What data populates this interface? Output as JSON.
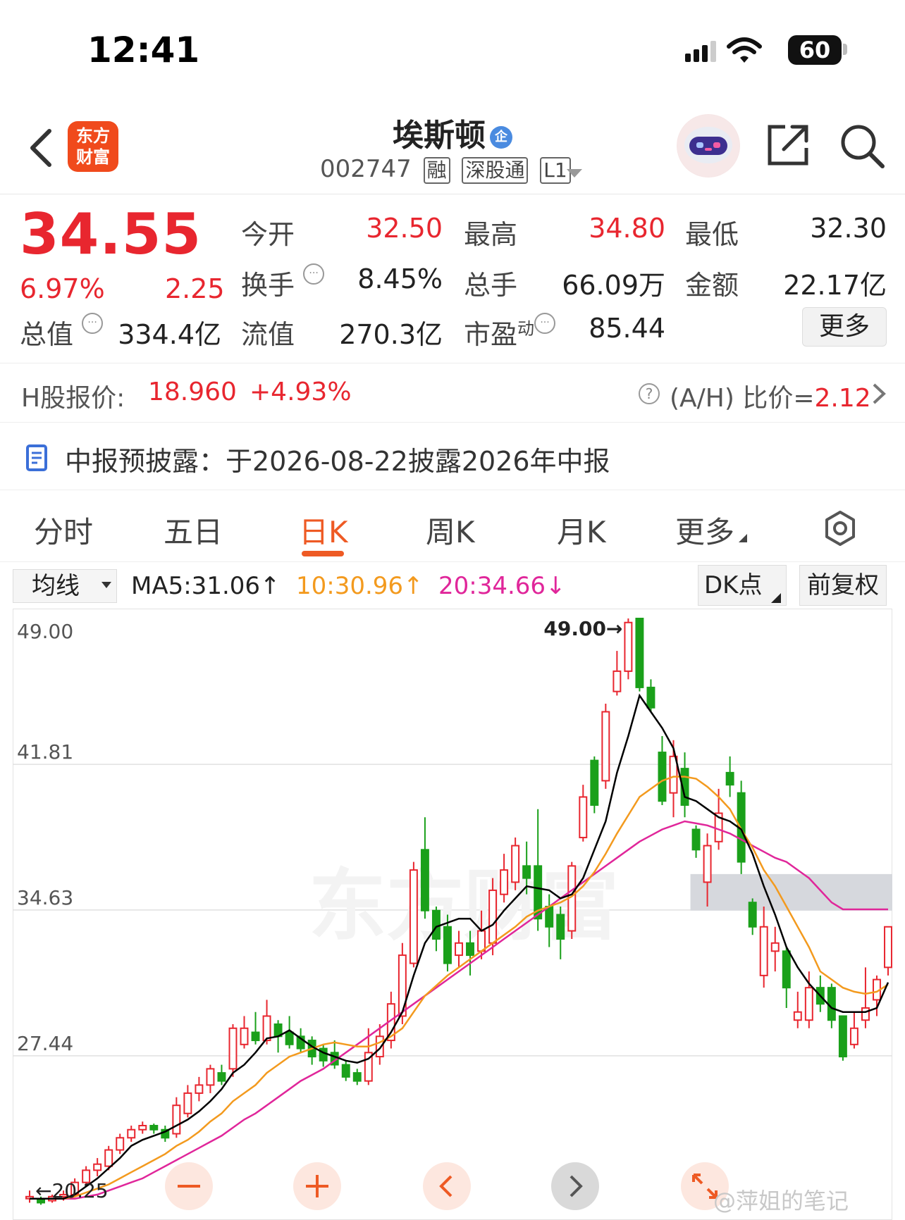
{
  "status_bar": {
    "time": "12:41",
    "battery": "60"
  },
  "header": {
    "app_logo_line1": "东方",
    "app_logo_line2": "财富",
    "stock_name": "埃斯顿",
    "verified_badge": "企",
    "stock_code": "002747",
    "tags": [
      "融",
      "深股通",
      "L1"
    ]
  },
  "quote": {
    "price": "34.55",
    "change_pct": "6.97%",
    "change_abs": "2.25",
    "fields": [
      {
        "label": "今开",
        "value": "32.50",
        "red": true
      },
      {
        "label": "最高",
        "value": "34.80",
        "red": true
      },
      {
        "label": "最低",
        "value": "32.30",
        "red": false
      },
      {
        "label": "换手",
        "value": "8.45%",
        "red": false
      },
      {
        "label": "总手",
        "value": "66.09万",
        "red": false
      },
      {
        "label": "金额",
        "value": "22.17亿",
        "red": false
      },
      {
        "label": "总值",
        "value": "334.4亿",
        "red": false
      },
      {
        "label": "流值",
        "value": "270.3亿",
        "red": false
      },
      {
        "label": "市盈",
        "value": "85.44",
        "red": false
      }
    ],
    "pe_superscript": "动",
    "more_label": "更多"
  },
  "hk": {
    "label": "H股报价:",
    "price": "18.960",
    "change": "+4.93%",
    "ratio_label": "(A/H) 比价=",
    "ratio_value": "2.12"
  },
  "report": {
    "text": "中报预披露：于2026-08-22披露2026年中报"
  },
  "tabs": [
    "分时",
    "五日",
    "日K",
    "周K",
    "月K",
    "更多"
  ],
  "active_tab": "日K",
  "ma_bar": {
    "select_label": "均线",
    "ma5": "MA5:31.06",
    "ma10": "10:30.96",
    "ma20": "20:34.66",
    "dk_label": "DK点",
    "adjust_label": "前复权"
  },
  "colors": {
    "up": "#e8262f",
    "down": "#1aa01a",
    "ma5": "#000000",
    "ma10": "#f39a1e",
    "ma20": "#e0269a",
    "accent": "#ee5a24"
  },
  "chart_data": {
    "type": "candlestick",
    "y_ticks": [
      "49.00",
      "41.81",
      "34.63",
      "27.44"
    ],
    "ylim": [
      20.25,
      49.0
    ],
    "high_marker": "49.00",
    "low_marker": "20.25",
    "candles": [
      [
        20.4,
        20.5,
        20.2,
        20.8
      ],
      [
        20.4,
        20.2,
        20.1,
        20.5
      ],
      [
        20.3,
        20.5,
        20.2,
        20.6
      ],
      [
        20.5,
        20.6,
        20.3,
        20.8
      ],
      [
        20.6,
        21.2,
        20.5,
        21.4
      ],
      [
        21.2,
        21.8,
        21.0,
        22.0
      ],
      [
        21.8,
        22.1,
        21.5,
        22.4
      ],
      [
        22.0,
        22.8,
        21.8,
        23.0
      ],
      [
        22.8,
        23.4,
        22.6,
        23.6
      ],
      [
        23.4,
        23.8,
        23.2,
        24.0
      ],
      [
        23.8,
        24.0,
        23.6,
        24.2
      ],
      [
        24.0,
        23.8,
        23.6,
        24.1
      ],
      [
        23.8,
        23.4,
        23.2,
        24.0
      ],
      [
        23.6,
        25.0,
        23.4,
        25.4
      ],
      [
        24.6,
        25.6,
        24.4,
        26.0
      ],
      [
        25.6,
        26.0,
        25.2,
        26.4
      ],
      [
        26.0,
        26.8,
        25.6,
        27.0
      ],
      [
        26.6,
        26.2,
        26.0,
        27.0
      ],
      [
        26.8,
        28.8,
        26.4,
        29.0
      ],
      [
        28.0,
        28.8,
        27.8,
        29.4
      ],
      [
        28.6,
        28.2,
        28.0,
        29.6
      ],
      [
        28.2,
        29.4,
        28.0,
        30.2
      ],
      [
        29.0,
        28.4,
        27.6,
        29.2
      ],
      [
        28.6,
        28.0,
        27.8,
        29.4
      ],
      [
        28.4,
        27.8,
        27.6,
        28.8
      ],
      [
        28.2,
        27.4,
        27.0,
        28.4
      ],
      [
        27.8,
        27.2,
        26.9,
        28.0
      ],
      [
        27.6,
        27.0,
        26.8,
        28.2
      ],
      [
        27.0,
        26.4,
        26.2,
        27.2
      ],
      [
        26.6,
        26.2,
        26.0,
        26.8
      ],
      [
        26.2,
        27.6,
        26.0,
        28.8
      ],
      [
        27.4,
        28.4,
        27.0,
        29.0
      ],
      [
        28.2,
        30.0,
        27.8,
        30.6
      ],
      [
        29.4,
        32.4,
        29.0,
        33.0
      ],
      [
        32.0,
        36.6,
        31.8,
        37.0
      ],
      [
        37.6,
        34.6,
        34.2,
        39.2
      ],
      [
        34.6,
        33.2,
        32.6,
        34.8
      ],
      [
        33.8,
        32.0,
        31.6,
        34.4
      ],
      [
        32.4,
        33.0,
        31.8,
        33.6
      ],
      [
        33.0,
        32.4,
        31.4,
        33.6
      ],
      [
        32.6,
        33.6,
        32.2,
        34.6
      ],
      [
        33.0,
        35.6,
        32.4,
        36.2
      ],
      [
        35.4,
        36.6,
        35.0,
        37.4
      ],
      [
        36.0,
        37.8,
        35.6,
        38.2
      ],
      [
        36.8,
        36.2,
        35.4,
        38.0
      ],
      [
        36.8,
        34.2,
        33.6,
        39.6
      ],
      [
        34.8,
        33.8,
        32.8,
        35.4
      ],
      [
        34.4,
        33.2,
        32.2,
        34.8
      ],
      [
        33.6,
        36.8,
        33.2,
        37.0
      ],
      [
        38.2,
        40.2,
        38.0,
        40.8
      ],
      [
        42.0,
        39.8,
        39.4,
        42.2
      ],
      [
        41.0,
        44.4,
        40.6,
        44.8
      ],
      [
        45.4,
        46.4,
        45.2,
        47.4
      ],
      [
        46.4,
        48.8,
        46.0,
        49.0
      ],
      [
        49.0,
        45.6,
        45.4,
        49.0
      ],
      [
        45.6,
        44.6,
        44.4,
        46.0
      ],
      [
        42.4,
        40.0,
        39.8,
        43.2
      ],
      [
        40.4,
        42.2,
        39.2,
        43.0
      ],
      [
        41.6,
        39.8,
        39.2,
        42.4
      ],
      [
        38.6,
        37.6,
        37.2,
        38.8
      ],
      [
        36.0,
        37.8,
        34.8,
        38.4
      ],
      [
        38.0,
        39.4,
        37.6,
        40.6
      ],
      [
        41.4,
        40.8,
        40.2,
        42.2
      ],
      [
        40.4,
        37.0,
        36.4,
        41.0
      ],
      [
        35.0,
        33.8,
        33.4,
        35.2
      ],
      [
        31.4,
        33.8,
        30.8,
        34.8
      ],
      [
        32.6,
        33.0,
        31.6,
        33.8
      ],
      [
        32.6,
        30.8,
        29.8,
        32.8
      ],
      [
        29.2,
        29.6,
        28.8,
        30.6
      ],
      [
        29.2,
        30.8,
        28.8,
        31.6
      ],
      [
        30.8,
        30.0,
        29.6,
        31.4
      ],
      [
        30.8,
        29.2,
        28.8,
        31.0
      ],
      [
        29.4,
        27.4,
        27.2,
        29.4
      ],
      [
        28.0,
        28.8,
        27.8,
        29.6
      ],
      [
        29.2,
        29.8,
        28.8,
        31.8
      ],
      [
        30.2,
        31.2,
        29.4,
        31.4
      ],
      [
        31.8,
        33.8,
        31.4,
        33.8
      ]
    ],
    "ma5": [
      20.4,
      20.4,
      20.4,
      20.4,
      20.6,
      21.0,
      21.4,
      21.9,
      22.4,
      23.0,
      23.3,
      23.5,
      23.7,
      24.0,
      24.3,
      24.7,
      25.2,
      25.8,
      26.6,
      27.0,
      27.6,
      28.3,
      28.4,
      28.7,
      28.3,
      27.9,
      27.6,
      27.4,
      27.2,
      27.1,
      27.3,
      27.8,
      28.6,
      29.6,
      31.4,
      33.0,
      33.8,
      34.0,
      34.2,
      34.2,
      33.6,
      33.9,
      34.6,
      35.2,
      35.8,
      35.7,
      35.6,
      35.2,
      35.4,
      36.2,
      37.6,
      39.0,
      41.4,
      43.2,
      45.2,
      44.4,
      43.6,
      42.6,
      40.2,
      40.0,
      39.6,
      39.2,
      39.0,
      38.6,
      37.4,
      35.8,
      34.4,
      32.8,
      31.8,
      31.0,
      30.4,
      29.8,
      29.6,
      29.6,
      29.6,
      29.8,
      31.06
    ],
    "ma10": [
      20.4,
      20.4,
      20.4,
      20.4,
      20.5,
      20.7,
      20.9,
      21.1,
      21.4,
      21.7,
      22.0,
      22.3,
      22.6,
      23.0,
      23.3,
      23.7,
      24.2,
      24.6,
      25.2,
      25.6,
      26.0,
      26.6,
      27.0,
      27.4,
      27.6,
      27.8,
      28.0,
      28.1,
      28.0,
      27.9,
      27.9,
      28.1,
      28.4,
      28.8,
      29.6,
      30.4,
      30.9,
      31.4,
      31.8,
      32.2,
      32.6,
      33.0,
      33.4,
      33.8,
      34.3,
      34.6,
      34.8,
      35.0,
      35.3,
      35.8,
      36.5,
      37.4,
      38.4,
      39.3,
      40.2,
      40.6,
      41.0,
      41.2,
      41.2,
      41.1,
      40.7,
      40.2,
      39.6,
      38.6,
      37.7,
      36.6,
      35.8,
      34.8,
      33.8,
      32.8,
      31.6,
      31.2,
      30.8,
      30.6,
      30.5,
      30.6,
      30.96
    ],
    "ma20": [
      20.4,
      20.4,
      20.4,
      20.4,
      20.4,
      20.5,
      20.6,
      20.8,
      21.0,
      21.2,
      21.4,
      21.7,
      22.0,
      22.3,
      22.6,
      22.9,
      23.2,
      23.5,
      23.9,
      24.3,
      24.6,
      25.0,
      25.4,
      25.8,
      26.2,
      26.5,
      26.8,
      27.2,
      27.6,
      28.0,
      28.4,
      28.8,
      29.2,
      29.6,
      30.0,
      30.4,
      30.8,
      31.2,
      31.6,
      32.0,
      32.4,
      32.8,
      33.2,
      33.6,
      34.0,
      34.4,
      34.8,
      35.2,
      35.6,
      36.0,
      36.4,
      36.8,
      37.2,
      37.6,
      38.0,
      38.3,
      38.6,
      38.8,
      39.0,
      38.9,
      38.8,
      38.6,
      38.4,
      38.1,
      37.8,
      37.5,
      37.2,
      37.0,
      36.6,
      36.2,
      35.6,
      35.0,
      34.66,
      34.66,
      34.66,
      34.66,
      34.66
    ],
    "ma_directions": {
      "ma5": "up",
      "ma10": "up",
      "ma20": "down"
    }
  },
  "chart_controls": [
    "zoom-out",
    "zoom-in",
    "prev",
    "next",
    "fullscreen"
  ],
  "watermark": {
    "chart_brand": "东方财富",
    "corner_text": "@萍姐的笔记"
  }
}
